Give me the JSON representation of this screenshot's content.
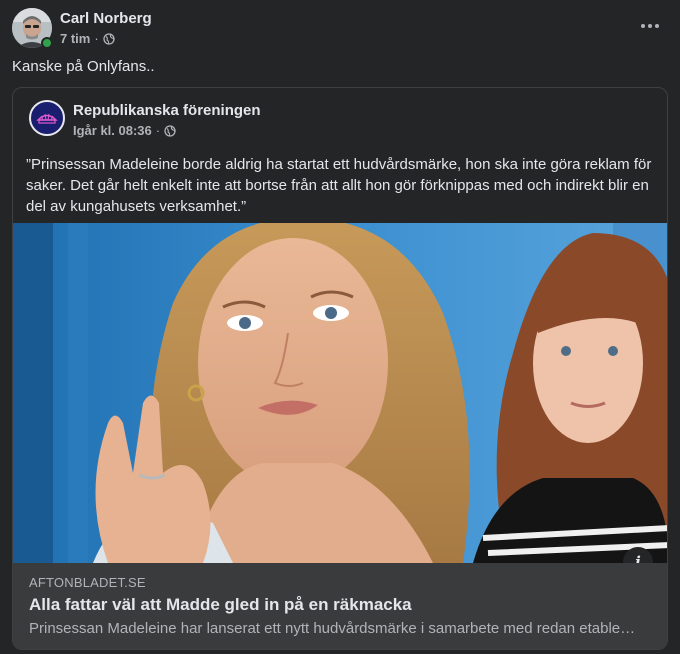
{
  "post": {
    "author": "Carl Norberg",
    "time": "7 tim",
    "separator": "·",
    "privacy_icon": "globe-icon",
    "text": "Kanske på Onlyfans.."
  },
  "shared": {
    "page_name": "Republikanska föreningen",
    "time": "Igår kl. 08:36",
    "separator": "·",
    "privacy_icon": "globe-icon",
    "text": "”Prinsessan Madeleine borde aldrig ha startat ett hudvårdsmärke, hon ska inte göra reklam för saker. Det går helt enkelt inte att bortse från att allt hon gör förknippas med och indirekt blir en del av kungahusets verksamhet.”"
  },
  "link": {
    "domain": "AFTONBLADET.SE",
    "title": "Alla fattar väl att Madde gled in på en räkmacka",
    "description": "Prinsessan Madeleine har lanserat ett nytt hudvårdsmärke i samarbete med redan etablerade…",
    "info_label": "i"
  },
  "colors": {
    "background": "#242526",
    "card_footer": "#3a3b3c",
    "online": "#31a24c",
    "text_primary": "#e4e6eb",
    "text_secondary": "#b0b3b8"
  }
}
